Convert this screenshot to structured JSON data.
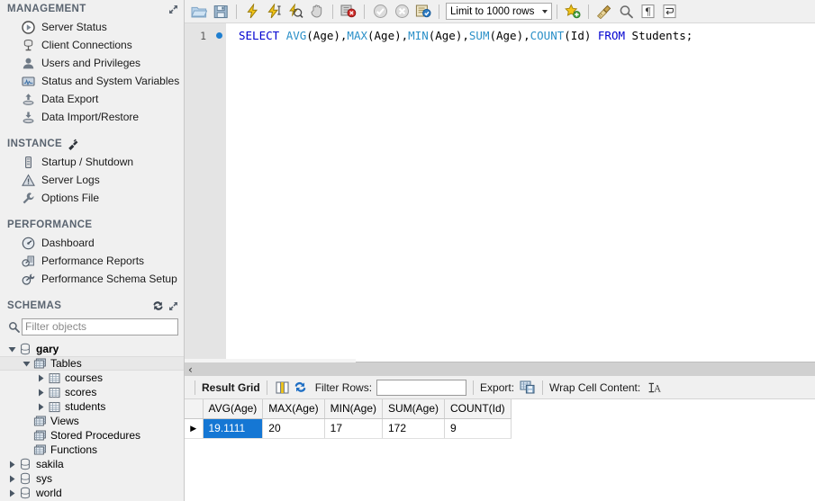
{
  "sidebar": {
    "management": {
      "title": "MANAGEMENT",
      "header_icon": "expand-panel-icon",
      "items": [
        {
          "label": "Server Status",
          "icon": "server-status-icon"
        },
        {
          "label": "Client Connections",
          "icon": "client-connections-icon"
        },
        {
          "label": "Users and Privileges",
          "icon": "users-privileges-icon"
        },
        {
          "label": "Status and System Variables",
          "icon": "status-variables-icon"
        },
        {
          "label": "Data Export",
          "icon": "data-export-icon"
        },
        {
          "label": "Data Import/Restore",
          "icon": "data-import-icon"
        }
      ]
    },
    "instance": {
      "title": "INSTANCE",
      "header_icon": "disconnect-plug-icon",
      "items": [
        {
          "label": "Startup / Shutdown",
          "icon": "startup-shutdown-icon"
        },
        {
          "label": "Server Logs",
          "icon": "server-logs-icon"
        },
        {
          "label": "Options File",
          "icon": "options-file-icon"
        }
      ]
    },
    "performance": {
      "title": "PERFORMANCE",
      "items": [
        {
          "label": "Dashboard",
          "icon": "dashboard-icon"
        },
        {
          "label": "Performance Reports",
          "icon": "performance-reports-icon"
        },
        {
          "label": "Performance Schema Setup",
          "icon": "performance-schema-icon"
        }
      ]
    },
    "schemas": {
      "title": "SCHEMAS",
      "refresh_icon": "refresh-icon",
      "expand_icon": "expand-panel-icon",
      "filter_placeholder": "Filter objects",
      "filter_value": "",
      "tree": [
        {
          "label": "gary",
          "icon": "schema-icon",
          "indent": 0,
          "expanded": true,
          "bold": true,
          "selected": false
        },
        {
          "label": "Tables",
          "icon": "folder-db-icon",
          "indent": 1,
          "expanded": true,
          "bold": false,
          "selected": true
        },
        {
          "label": "courses",
          "icon": "table-icon",
          "indent": 2,
          "expanded": false,
          "bold": false,
          "selected": false
        },
        {
          "label": "scores",
          "icon": "table-icon",
          "indent": 2,
          "expanded": false,
          "bold": false,
          "selected": false
        },
        {
          "label": "students",
          "icon": "table-icon",
          "indent": 2,
          "expanded": false,
          "bold": false,
          "selected": false
        },
        {
          "label": "Views",
          "icon": "folder-db-icon",
          "indent": 1,
          "expanded": null,
          "bold": false,
          "selected": false
        },
        {
          "label": "Stored Procedures",
          "icon": "folder-db-icon",
          "indent": 1,
          "expanded": null,
          "bold": false,
          "selected": false
        },
        {
          "label": "Functions",
          "icon": "folder-db-icon",
          "indent": 1,
          "expanded": null,
          "bold": false,
          "selected": false
        },
        {
          "label": "sakila",
          "icon": "schema-icon",
          "indent": 0,
          "expanded": false,
          "bold": false,
          "selected": false
        },
        {
          "label": "sys",
          "icon": "schema-icon",
          "indent": 0,
          "expanded": false,
          "bold": false,
          "selected": false
        },
        {
          "label": "world",
          "icon": "schema-icon",
          "indent": 0,
          "expanded": false,
          "bold": false,
          "selected": false
        }
      ]
    }
  },
  "toolbar": {
    "buttons": [
      "open-sql-file-icon",
      "save-sql-file-icon",
      "execute-statement-icon",
      "execute-current-statement-icon",
      "explain-statement-icon",
      "stop-execution-icon",
      "toggle-execution-stop-icon",
      "commit-icon",
      "rollback-icon",
      "autocommit-icon"
    ],
    "limit_label": "Limit to 1000 rows",
    "right_buttons": [
      "add-snippet-icon",
      "beautify-query-icon",
      "find-icon",
      "show-invisible-chars-icon",
      "wrap-long-lines-icon"
    ]
  },
  "editor": {
    "line_number": "1",
    "tokens": [
      {
        "t": "SELECT",
        "c": "kw"
      },
      {
        "t": " ",
        "c": "pl"
      },
      {
        "t": "AVG",
        "c": "fn"
      },
      {
        "t": "(Age),",
        "c": "pl"
      },
      {
        "t": "MAX",
        "c": "fn"
      },
      {
        "t": "(Age),",
        "c": "pl"
      },
      {
        "t": "MIN",
        "c": "fn"
      },
      {
        "t": "(Age),",
        "c": "pl"
      },
      {
        "t": "SUM",
        "c": "fn"
      },
      {
        "t": "(Age),",
        "c": "pl"
      },
      {
        "t": "COUNT",
        "c": "fn"
      },
      {
        "t": "(Id) ",
        "c": "pl"
      },
      {
        "t": "FROM",
        "c": "kw"
      },
      {
        "t": " Students;",
        "c": "pl"
      }
    ]
  },
  "results": {
    "collapse_chevron": "‹",
    "tab_label": "Result Grid",
    "grid_icon": "result-grid-icon",
    "refresh_icon": "refresh-grid-icon",
    "filter_rows_label": "Filter Rows:",
    "filter_rows_value": "",
    "export_label": "Export:",
    "export_icon": "export-recordset-icon",
    "wrap_label": "Wrap Cell Content:",
    "wrap_icon": "wrap-cell-icon",
    "columns": [
      "AVG(Age)",
      "MAX(Age)",
      "MIN(Age)",
      "SUM(Age)",
      "COUNT(Id)"
    ],
    "rows": [
      {
        "marker": "▶",
        "cells": [
          "19.1111",
          "20",
          "17",
          "172",
          "9"
        ],
        "selected_index": 0
      }
    ]
  },
  "colors": {
    "accent_blue": "#1577d4",
    "keyword_blue": "#0000d0",
    "function_blue": "#2b90c8",
    "panel_bg": "#f0f0f0",
    "header_text": "#5a6470"
  }
}
